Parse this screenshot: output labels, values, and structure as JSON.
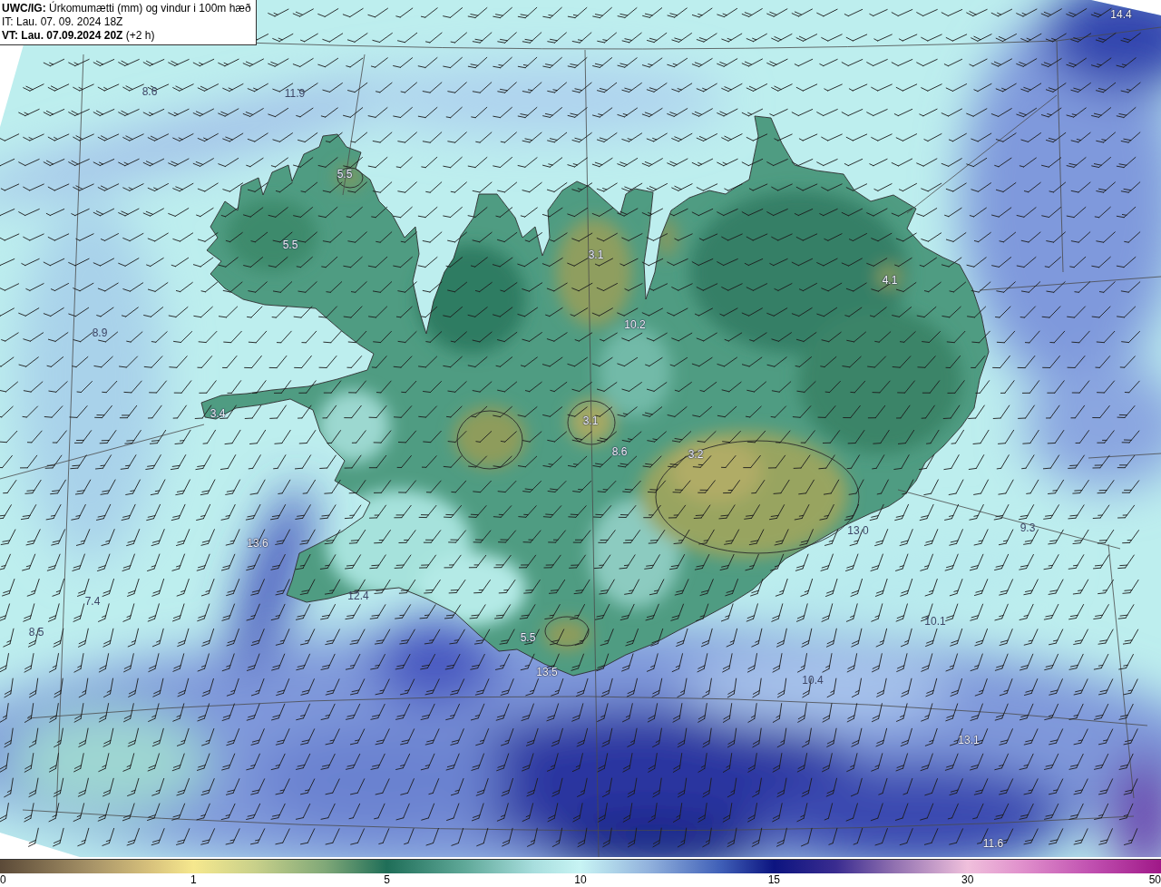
{
  "header": {
    "title": "**UWC/IG:** Úrkomumætti (mm) og vindur i 100m hæð",
    "issue_time": "IT: Lau. 07. 09. 2024 18Z",
    "valid_time": "**VT: Lau. 07.09.2024 20Z** (+2 h)"
  },
  "map": {
    "value_labels": [
      "14.4",
      "8.6",
      "11.9",
      "5.5",
      "5.5",
      "3.1",
      "4.1",
      "10.2",
      "8.9",
      "3.4",
      "3.1",
      "8.6",
      "3.2",
      "13.0",
      "9.3",
      "13.6",
      "12.4",
      "7.4",
      "8.5",
      "10.1",
      "5.5",
      "13.5",
      "10.4",
      "13.1",
      "11.6"
    ]
  },
  "color_scale": {
    "ticks": [
      "0",
      "1",
      "5",
      "10",
      "15",
      "30",
      "50"
    ]
  }
}
